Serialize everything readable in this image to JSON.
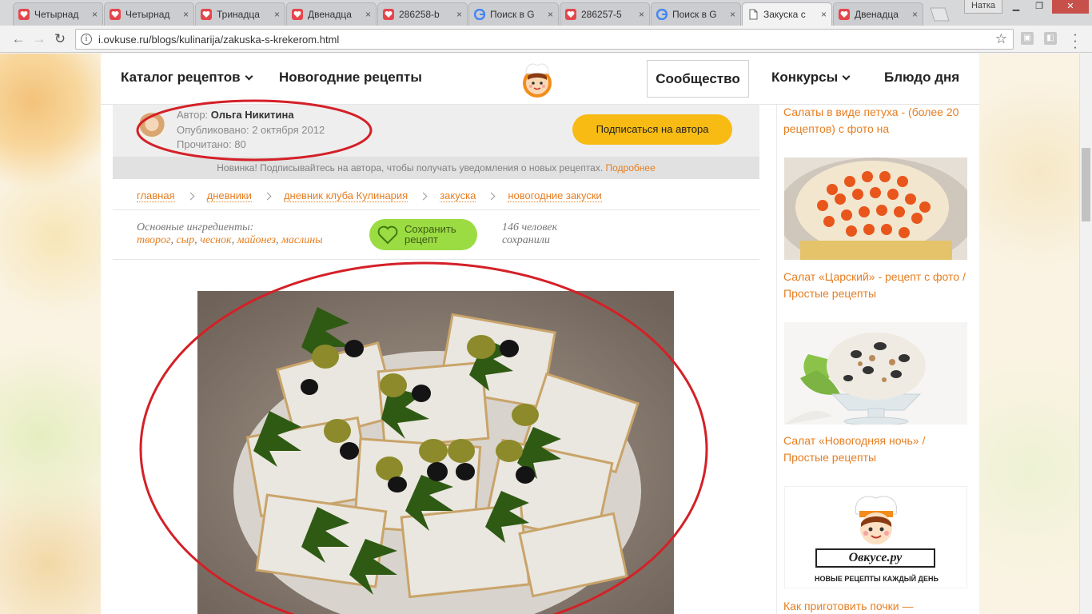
{
  "browser": {
    "tabs": [
      {
        "title": "Четырнад",
        "icon": "heart-favicon",
        "active": false
      },
      {
        "title": "Четырнад",
        "icon": "heart-favicon",
        "active": false
      },
      {
        "title": "Тринадца",
        "icon": "heart-favicon",
        "active": false
      },
      {
        "title": "Двенадца",
        "icon": "heart-favicon",
        "active": false
      },
      {
        "title": "286258-b",
        "icon": "heart-favicon",
        "active": false
      },
      {
        "title": "Поиск в G",
        "icon": "google-favicon",
        "active": false
      },
      {
        "title": "286257-5",
        "icon": "heart-favicon",
        "active": false
      },
      {
        "title": "Поиск в G",
        "icon": "google-favicon",
        "active": false
      },
      {
        "title": "Закуска с",
        "icon": "page-favicon",
        "active": true
      },
      {
        "title": "Двенадца",
        "icon": "heart-favicon",
        "active": false
      }
    ],
    "close_glyph": "×",
    "user": "Натка",
    "url": "i.ovkuse.ru/blogs/kulinarija/zakuska-s-krekerom.html",
    "colors": {
      "tab_heart": "#e4464c",
      "window_close": "#c7504b"
    }
  },
  "site_nav": {
    "catalog": "Каталог рецептов",
    "new_year": "Новогодние рецепты",
    "community": "Сообщество",
    "contests": "Конкурсы",
    "dish_of_day": "Блюдо дня"
  },
  "author": {
    "label": "Автор:",
    "name": "Ольга Никитина",
    "published": "Опубликовано: 2 октября 2012",
    "reads": "Прочитано: 80",
    "subscribe": "Подписаться на автора"
  },
  "notice": {
    "text": "Новинка! Подписывайтесь на автора, чтобы получать уведомления о новых рецептах. ",
    "link": "Подробнее"
  },
  "breadcrumbs": [
    "главная",
    "дневники",
    "дневник клуба Кулинария",
    "закуска",
    "новогодние закуски"
  ],
  "ingredients": {
    "label": "Основные ингредиенты:",
    "items": [
      "творог",
      "сыр",
      "чеснок",
      "майонез",
      "маслины"
    ],
    "separator": ", "
  },
  "save": {
    "label": "Сохранить рецепт",
    "count_line1": "146 человек",
    "count_line2": "сохранили"
  },
  "sidebar": {
    "items": [
      {
        "title": "Салаты в виде петуха - (более 20 рецептов) с фото на"
      },
      {
        "title": "Салат «Царский» - рецепт с фото / Простые рецепты"
      },
      {
        "title": "Салат «Новогодняя ночь» / Простые рецепты"
      },
      {
        "title": "Как приготовить почки —"
      }
    ],
    "promo": {
      "brand": "Овкусе.ру",
      "tagline": "НОВЫЕ РЕЦЕПТЫ КАЖДЫЙ ДЕНЬ"
    }
  },
  "colors": {
    "accent_orange": "#e67e22",
    "subscribe_yellow": "#f8bb14",
    "save_green": "#9bdc43",
    "annotation_red": "#d42027"
  }
}
